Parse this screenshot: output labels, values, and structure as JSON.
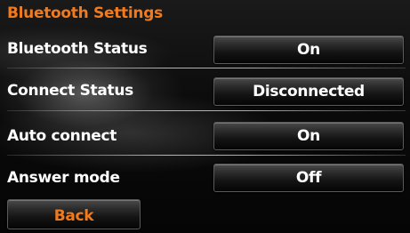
{
  "header": {
    "title": "Bluetooth Settings"
  },
  "settings": [
    {
      "label": "Bluetooth Status",
      "value": "On"
    },
    {
      "label": "Connect Status",
      "value": "Disconnected"
    },
    {
      "label": "Auto connect",
      "value": "On"
    },
    {
      "label": "Answer mode",
      "value": "Off"
    }
  ],
  "footer": {
    "back_label": "Back"
  },
  "colors": {
    "accent": "#f07a1e",
    "text": "#ffffff",
    "background": "#000000"
  }
}
